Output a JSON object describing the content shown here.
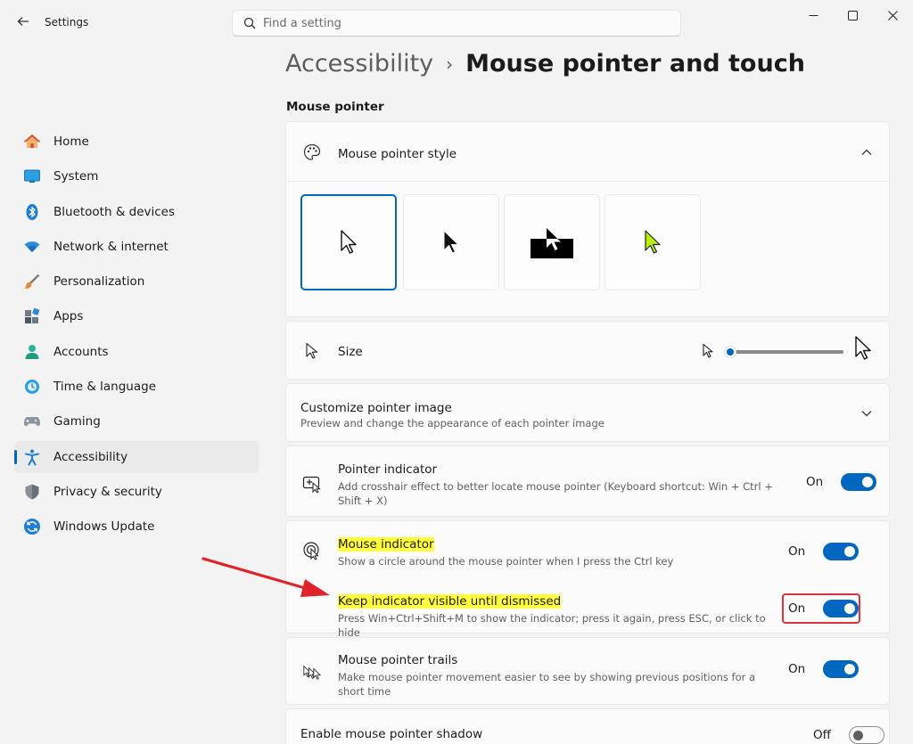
{
  "window": {
    "title": "Settings"
  },
  "search": {
    "placeholder": "Find a setting"
  },
  "sidebar": {
    "items": [
      {
        "label": "Home",
        "icon": "home-icon",
        "active": false
      },
      {
        "label": "System",
        "icon": "system-icon",
        "active": false
      },
      {
        "label": "Bluetooth & devices",
        "icon": "bluetooth-icon",
        "active": false
      },
      {
        "label": "Network & internet",
        "icon": "network-icon",
        "active": false
      },
      {
        "label": "Personalization",
        "icon": "brush-icon",
        "active": false
      },
      {
        "label": "Apps",
        "icon": "apps-icon",
        "active": false
      },
      {
        "label": "Accounts",
        "icon": "accounts-icon",
        "active": false
      },
      {
        "label": "Time & language",
        "icon": "time-language-icon",
        "active": false
      },
      {
        "label": "Gaming",
        "icon": "gaming-icon",
        "active": false
      },
      {
        "label": "Accessibility",
        "icon": "accessibility-icon",
        "active": true
      },
      {
        "label": "Privacy & security",
        "icon": "shield-icon",
        "active": false
      },
      {
        "label": "Windows Update",
        "icon": "update-icon",
        "active": false
      }
    ]
  },
  "breadcrumb": {
    "parent": "Accessibility",
    "separator": "›",
    "current": "Mouse pointer and touch"
  },
  "section": {
    "title": "Mouse pointer"
  },
  "pointer_style": {
    "title": "Mouse pointer style",
    "options": [
      "white-pointer",
      "black-pointer",
      "inverted-pointer",
      "custom-color-pointer"
    ],
    "selected": "white-pointer"
  },
  "size": {
    "title": "Size",
    "value_fraction": 0.0
  },
  "customize": {
    "title": "Customize pointer image",
    "desc": "Preview and change the appearance of each pointer image"
  },
  "pointer_indicator": {
    "title": "Pointer indicator",
    "desc": "Add crosshair effect to better locate mouse pointer (Keyboard shortcut: Win + Ctrl + Shift + X)",
    "state": "On"
  },
  "mouse_indicator": {
    "title": "Mouse indicator",
    "desc": "Show a circle around the mouse pointer when I press the Ctrl key",
    "state": "On"
  },
  "keep_indicator": {
    "title": "Keep indicator visible until dismissed",
    "desc": "Press Win+Ctrl+Shift+M to show the indicator; press it again, press ESC, or click to hide",
    "state": "On"
  },
  "trails": {
    "title": "Mouse pointer trails",
    "desc": "Make mouse pointer movement easier to see by showing previous positions for a short time",
    "state": "On"
  },
  "shadow": {
    "title": "Enable mouse pointer shadow",
    "state": "Off"
  },
  "colors": {
    "accent": "#0067c0",
    "highlight": "#ffff3a",
    "annotation": "#e0323a"
  }
}
